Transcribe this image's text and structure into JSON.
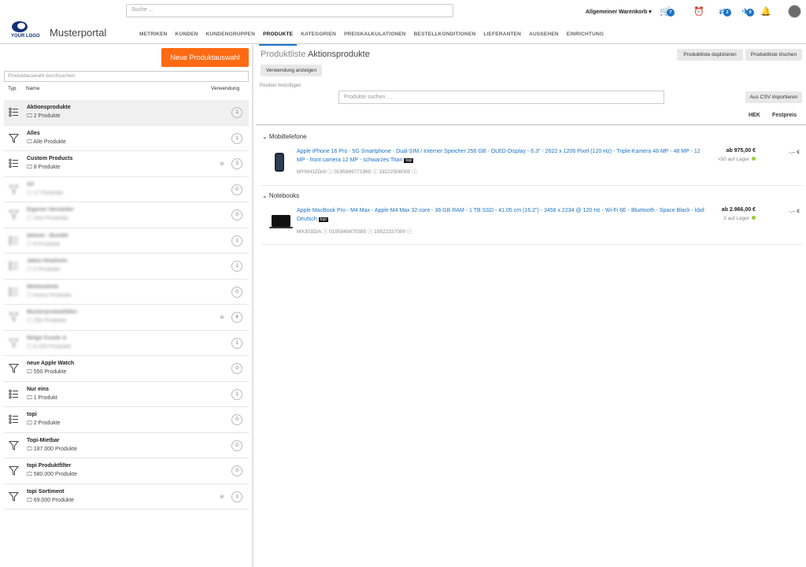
{
  "header": {
    "search_placeholder": "Suche ...",
    "logo_text": "YOUR LOGO",
    "portal_name": "Musterportal",
    "nav": [
      "METRIKEN",
      "KUNDEN",
      "KUNDENGRUPPEN",
      "PRODUKTE",
      "KATEGORIEN",
      "PREISKALKULATIONEN",
      "BESTELLKONDITIONEN",
      "LIEFERANTEN",
      "AUSSEHEN",
      "EINRICHTUNG"
    ],
    "active_nav": "PRODUKTE",
    "cart_label": "Allgemeiner Warenkorb ▾",
    "badges": {
      "cart": "7",
      "compare": "2",
      "notify": "9"
    },
    "accent": "#1a73c8"
  },
  "left": {
    "new_button": "Neue Produktauswahl",
    "search_placeholder": "Produktauswahl durchsuchen",
    "col_typ": "Typ",
    "col_name": "Name",
    "col_use": "Verwendung",
    "items": [
      {
        "name": "Aktionsprodukte",
        "sub": "2 Produkte",
        "count": "1",
        "type": "list",
        "active": true
      },
      {
        "name": "Alles",
        "sub": "Alle Produkte",
        "count": "1",
        "type": "filter"
      },
      {
        "name": "Custom Products",
        "sub": "8 Produkte",
        "count": "3",
        "type": "list",
        "shared": true
      },
      {
        "name": "All",
        "sub": "17 Produkte",
        "count": "0",
        "type": "filter",
        "blur": true
      },
      {
        "name": "Eigener Hersteller",
        "sub": "Vom Produkte",
        "count": "0",
        "type": "filter",
        "blur": true
      },
      {
        "name": "Iphone - Bundle",
        "sub": "8 Produkte",
        "count": "1",
        "type": "list",
        "blur": true
      },
      {
        "name": "Jabra Headsets",
        "sub": "5 Produkte",
        "count": "1",
        "type": "list",
        "blur": true
      },
      {
        "name": "Mietmodelle",
        "sub": "Keine Produkte",
        "count": "0",
        "type": "list",
        "blur": true
      },
      {
        "name": "Musterproduktfilter",
        "sub": "250 Produkte",
        "count": "4",
        "type": "filter",
        "blur": true,
        "shared": true
      },
      {
        "name": "Netgo Kunde A",
        "sub": "6.200 Produkte",
        "count": "1",
        "type": "filter",
        "blur": true
      },
      {
        "name": "neue Apple Watch",
        "sub": "550 Produkte",
        "count": "0",
        "type": "filter"
      },
      {
        "name": "Nur eins",
        "sub": "1 Produkt",
        "count": "1",
        "type": "list"
      },
      {
        "name": "topi",
        "sub": "2 Produkte",
        "count": "0",
        "type": "list"
      },
      {
        "name": "Topi-Mietbar",
        "sub": "187.000 Produkte",
        "count": "0",
        "type": "filter"
      },
      {
        "name": "topi Produktfilter",
        "sub": "580.000 Produkte",
        "count": "0",
        "type": "filter"
      },
      {
        "name": "topi Sortiment",
        "sub": "69.000 Produkte",
        "count": "1",
        "type": "filter",
        "shared": true
      }
    ]
  },
  "right": {
    "title_prefix": "Produktliste",
    "title": "Aktionsprodukte",
    "dup_button": "Produktliste duplizieren",
    "del_button": "Produktliste löschen",
    "usage_button": "Verwendung anzeigen",
    "add_label": "Position hinzufügen",
    "product_search_placeholder": "Produkte suchen ...",
    "csv_button": "Aus CSV importieren",
    "col_hek": "HEK",
    "col_fest": "Festpreis",
    "groups": [
      {
        "name": "Mobiltelefone",
        "products": [
          {
            "name": "Apple iPhone 16 Pro - 5G Smartphone - Dual-SIM / Interner Speicher 256 GB - OLED-Display - 6.3\" - 2622 x 1206 Pixel (120 Hz) - Triple-Kamera 48 MP - 48 MP - 12 MP - front camera 12 MP - schwarzes Titan",
            "tag": "topi",
            "sku": "MYNH3ZD/A",
            "ean": "0195949771965",
            "id": "19222506000",
            "price": "ab 975,00 €",
            "stock": ">50 auf Lager",
            "fest": "-,-- €"
          }
        ]
      },
      {
        "name": "Notebooks",
        "products": [
          {
            "name": "Apple MacBook Pro - M4 Max - Apple M4 Max 32-core - 36 GB RAM - 1 TB SSD - 41.05 cm (16.2\") - 3456 x 2234 @ 120 Hz - Wi-Fi 6E - Bluetooth - Space Black - kbd: Deutsch",
            "tag": "topi",
            "sku": "MX303D/A",
            "ean": "0195949870385",
            "id": "19522337000",
            "price": "ab 2.966,00 €",
            "stock": "3 auf Lager",
            "fest": "-,-- €"
          }
        ]
      }
    ]
  }
}
